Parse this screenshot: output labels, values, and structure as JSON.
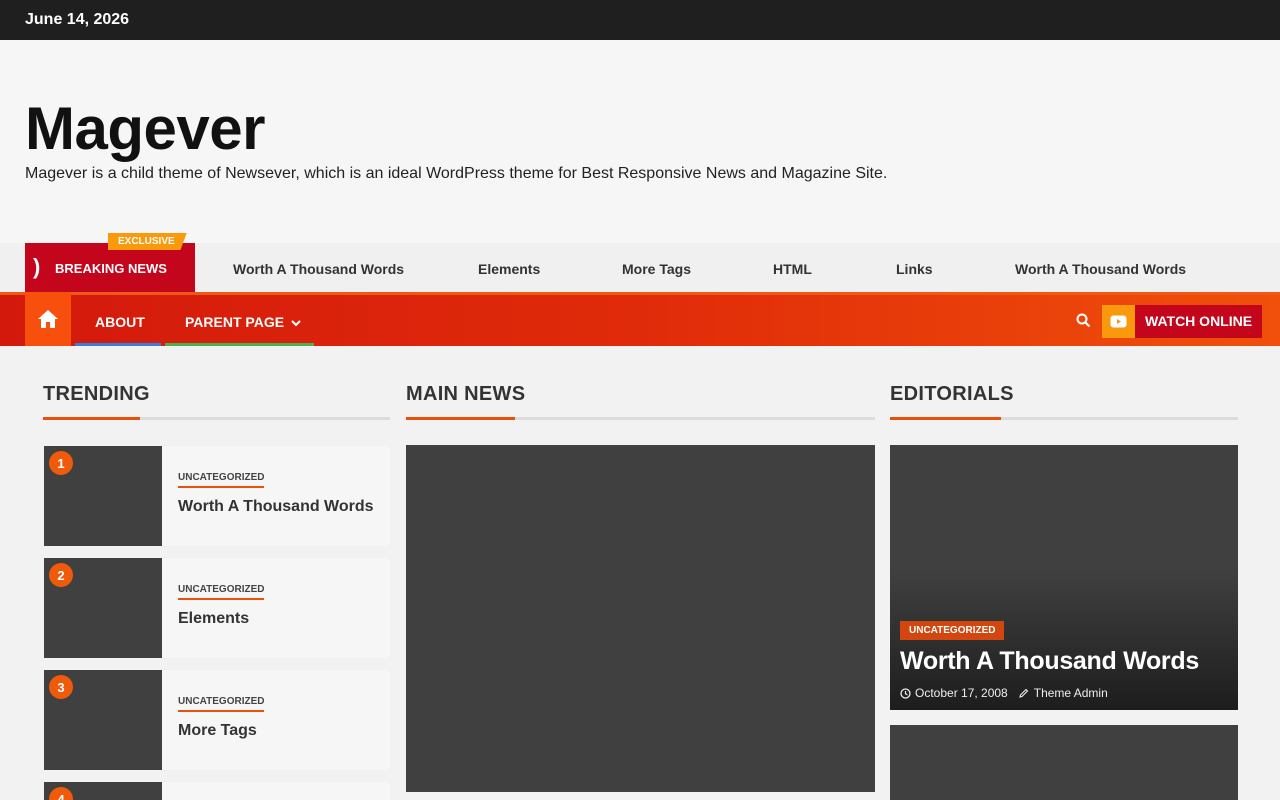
{
  "topbar": {
    "date": "June 14, 2026"
  },
  "header": {
    "site_title": "Magever",
    "site_description": "Magever is a child theme of Newsever, which is an ideal WordPress theme for Best Responsive News and Magazine Site."
  },
  "ticker": {
    "exclusive_label": "EXCLUSIVE",
    "breaking_label": "BREAKING NEWS",
    "items": [
      "Worth A Thousand Words",
      "Elements",
      "More Tags",
      "HTML",
      "Links",
      "Worth A Thousand Words"
    ]
  },
  "nav": {
    "home_icon": "home-icon",
    "items": [
      {
        "label": "ABOUT",
        "underline_color": "#3b7ddd"
      },
      {
        "label": "PARENT PAGE",
        "underline_color": "#4caf50"
      }
    ],
    "watch_label": "WATCH ONLINE",
    "colors": {
      "accent": "#ef5a0b",
      "red": "#c4061d",
      "orange": "#f99a0c"
    }
  },
  "sections": {
    "trending": "TRENDING",
    "main_news": "MAIN NEWS",
    "editorials": "EDITORIALS"
  },
  "trending": [
    {
      "rank": "1",
      "category": "UNCATEGORIZED",
      "title": "Worth A Thousand Words"
    },
    {
      "rank": "2",
      "category": "UNCATEGORIZED",
      "title": "Elements"
    },
    {
      "rank": "3",
      "category": "UNCATEGORIZED",
      "title": "More Tags"
    },
    {
      "rank": "4"
    }
  ],
  "editorials": [
    {
      "category": "UNCATEGORIZED",
      "title": "Worth A Thousand Words",
      "date": "October 17, 2008",
      "author": "Theme Admin"
    }
  ]
}
